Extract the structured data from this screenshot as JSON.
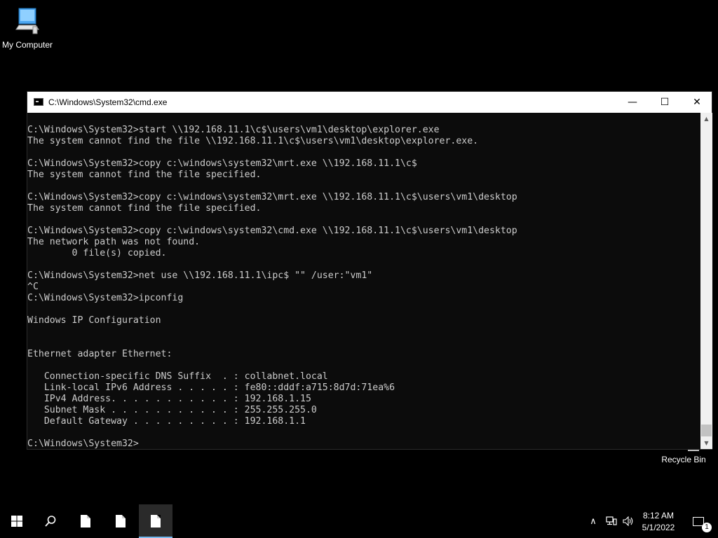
{
  "desktop": {
    "icons": [
      {
        "label": "My Computer",
        "icon": "computer-icon"
      },
      {
        "label": "Recycle Bin",
        "icon": "recycle-bin-icon"
      }
    ]
  },
  "window": {
    "title": "C:\\Windows\\System32\\cmd.exe",
    "minimize_glyph": "—",
    "maximize_glyph": "☐",
    "close_glyph": "✕"
  },
  "console": {
    "lines": [
      "C:\\Windows\\System32>start \\\\192.168.11.1\\c$\\users\\vm1\\desktop\\explorer.exe",
      "The system cannot find the file \\\\192.168.11.1\\c$\\users\\vm1\\desktop\\explorer.exe.",
      "",
      "C:\\Windows\\System32>copy c:\\windows\\system32\\mrt.exe \\\\192.168.11.1\\c$",
      "The system cannot find the file specified.",
      "",
      "C:\\Windows\\System32>copy c:\\windows\\system32\\mrt.exe \\\\192.168.11.1\\c$\\users\\vm1\\desktop",
      "The system cannot find the file specified.",
      "",
      "C:\\Windows\\System32>copy c:\\windows\\system32\\cmd.exe \\\\192.168.11.1\\c$\\users\\vm1\\desktop",
      "The network path was not found.",
      "        0 file(s) copied.",
      "",
      "C:\\Windows\\System32>net use \\\\192.168.11.1\\ipc$ \"\" /user:\"vm1\"",
      "^C",
      "C:\\Windows\\System32>ipconfig",
      "",
      "Windows IP Configuration",
      "",
      "",
      "Ethernet adapter Ethernet:",
      "",
      "   Connection-specific DNS Suffix  . : collabnet.local",
      "   Link-local IPv6 Address . . . . . : fe80::dddf:a715:8d7d:71ea%6",
      "   IPv4 Address. . . . . . . . . . . : 192.168.1.15",
      "   Subnet Mask . . . . . . . . . . . : 255.255.255.0",
      "   Default Gateway . . . . . . . . . : 192.168.1.1",
      "",
      "C:\\Windows\\System32>"
    ]
  },
  "taskbar": {
    "items": [
      {
        "name": "start-button",
        "icon": "windows-logo-icon"
      },
      {
        "name": "search-button",
        "icon": "search-icon"
      },
      {
        "name": "taskbar-app-1",
        "icon": "document-icon"
      },
      {
        "name": "taskbar-app-2",
        "icon": "document-icon"
      },
      {
        "name": "taskbar-app-3",
        "icon": "document-icon",
        "active": true
      }
    ],
    "tray": {
      "chevron_glyph": "∧",
      "network_icon": "network-icon",
      "volume_glyph": "🕪"
    },
    "clock": {
      "time": "8:12 AM",
      "date": "5/1/2022"
    },
    "notifications": {
      "count": "1"
    }
  },
  "colors": {
    "console_bg": "#0c0c0c",
    "console_fg": "#cccccc",
    "accent": "#76b9ed"
  }
}
